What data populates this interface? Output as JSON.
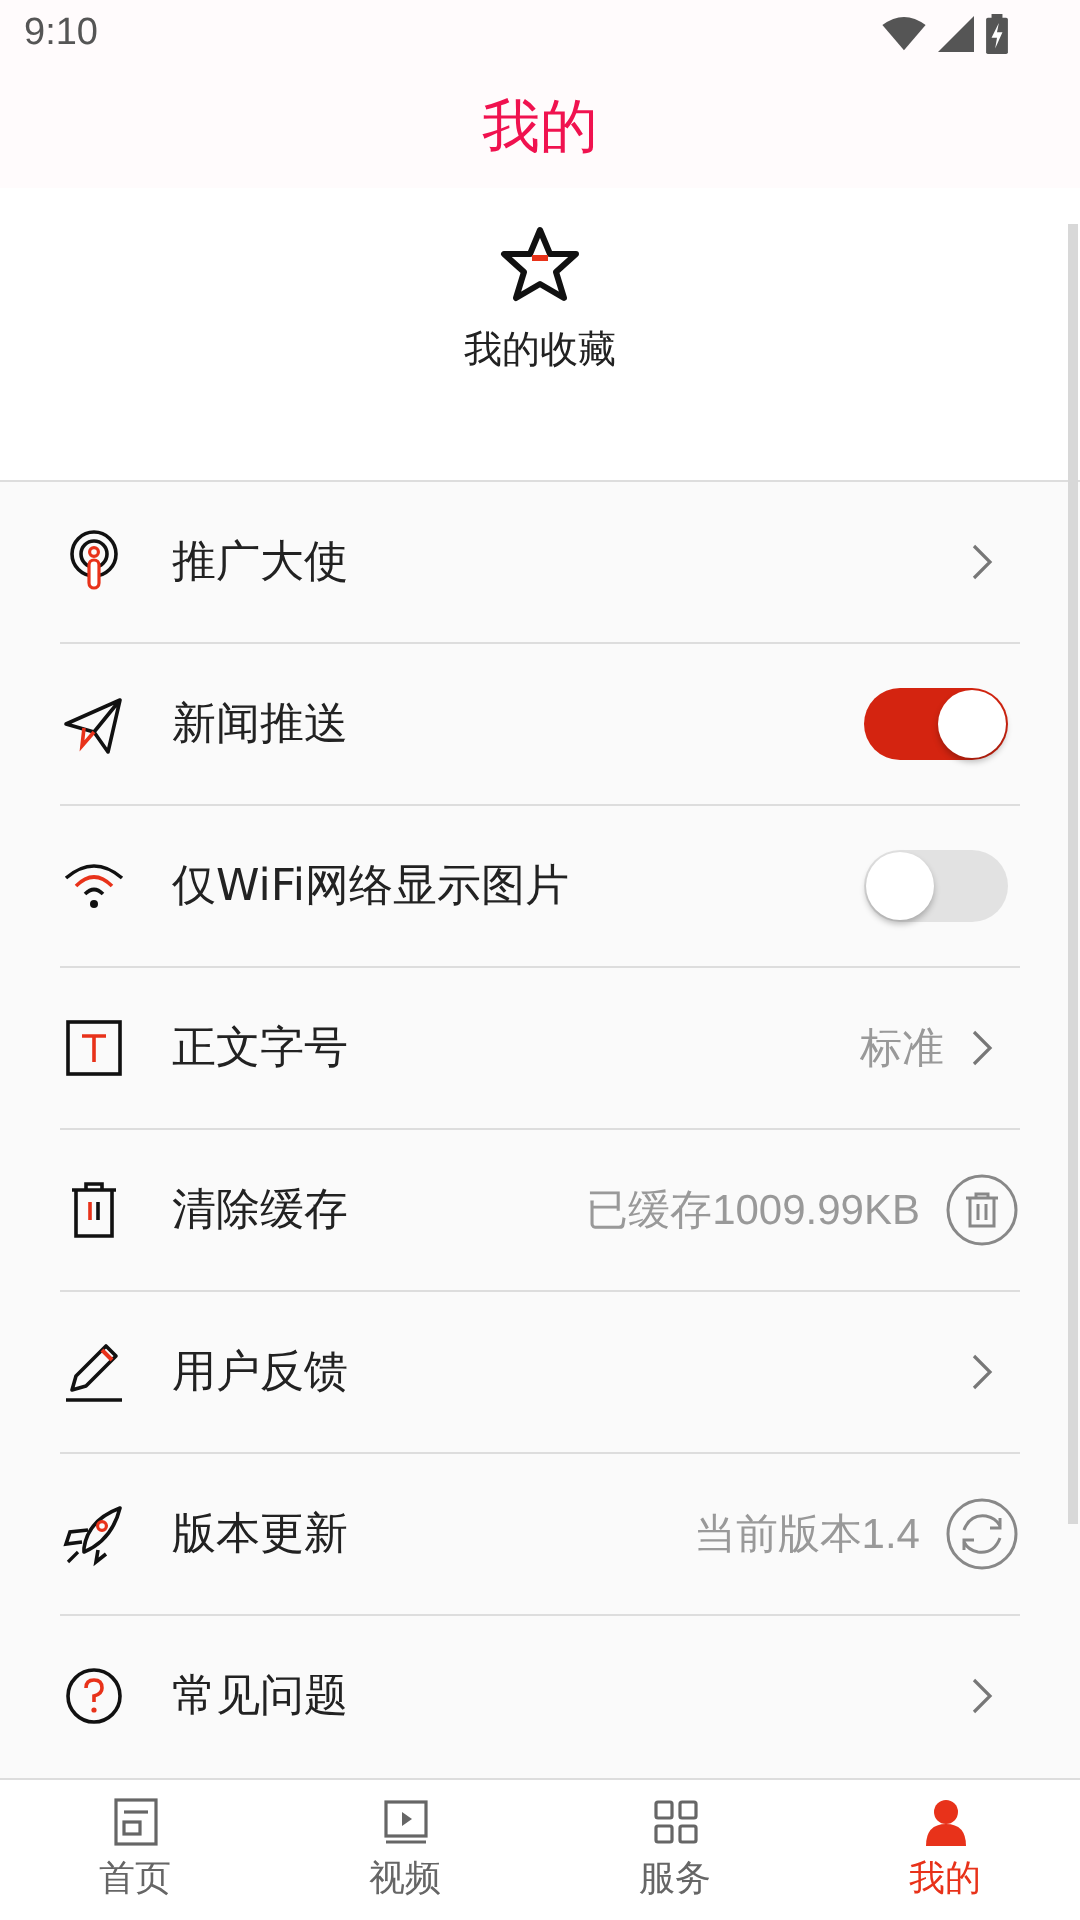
{
  "status_bar": {
    "time": "9:10"
  },
  "header": {
    "title": "我的"
  },
  "favorites": {
    "label": "我的收藏"
  },
  "settings": [
    {
      "kind": "link",
      "label": "推广大使"
    },
    {
      "kind": "toggle",
      "label": "新闻推送",
      "on": true
    },
    {
      "kind": "toggle",
      "label": "仅WiFi网络显示图片",
      "on": false
    },
    {
      "kind": "link",
      "label": "正文字号",
      "value": "标准"
    },
    {
      "kind": "action",
      "label": "清除缓存",
      "value": "已缓存1009.99KB"
    },
    {
      "kind": "link",
      "label": "用户反馈"
    },
    {
      "kind": "action",
      "label": "版本更新",
      "value": "当前版本1.4"
    },
    {
      "kind": "link",
      "label": "常见问题"
    }
  ],
  "tabs": [
    {
      "label": "首页",
      "selected": false
    },
    {
      "label": "视频",
      "selected": false
    },
    {
      "label": "服务",
      "selected": false
    },
    {
      "label": "我的",
      "selected": true
    }
  ]
}
